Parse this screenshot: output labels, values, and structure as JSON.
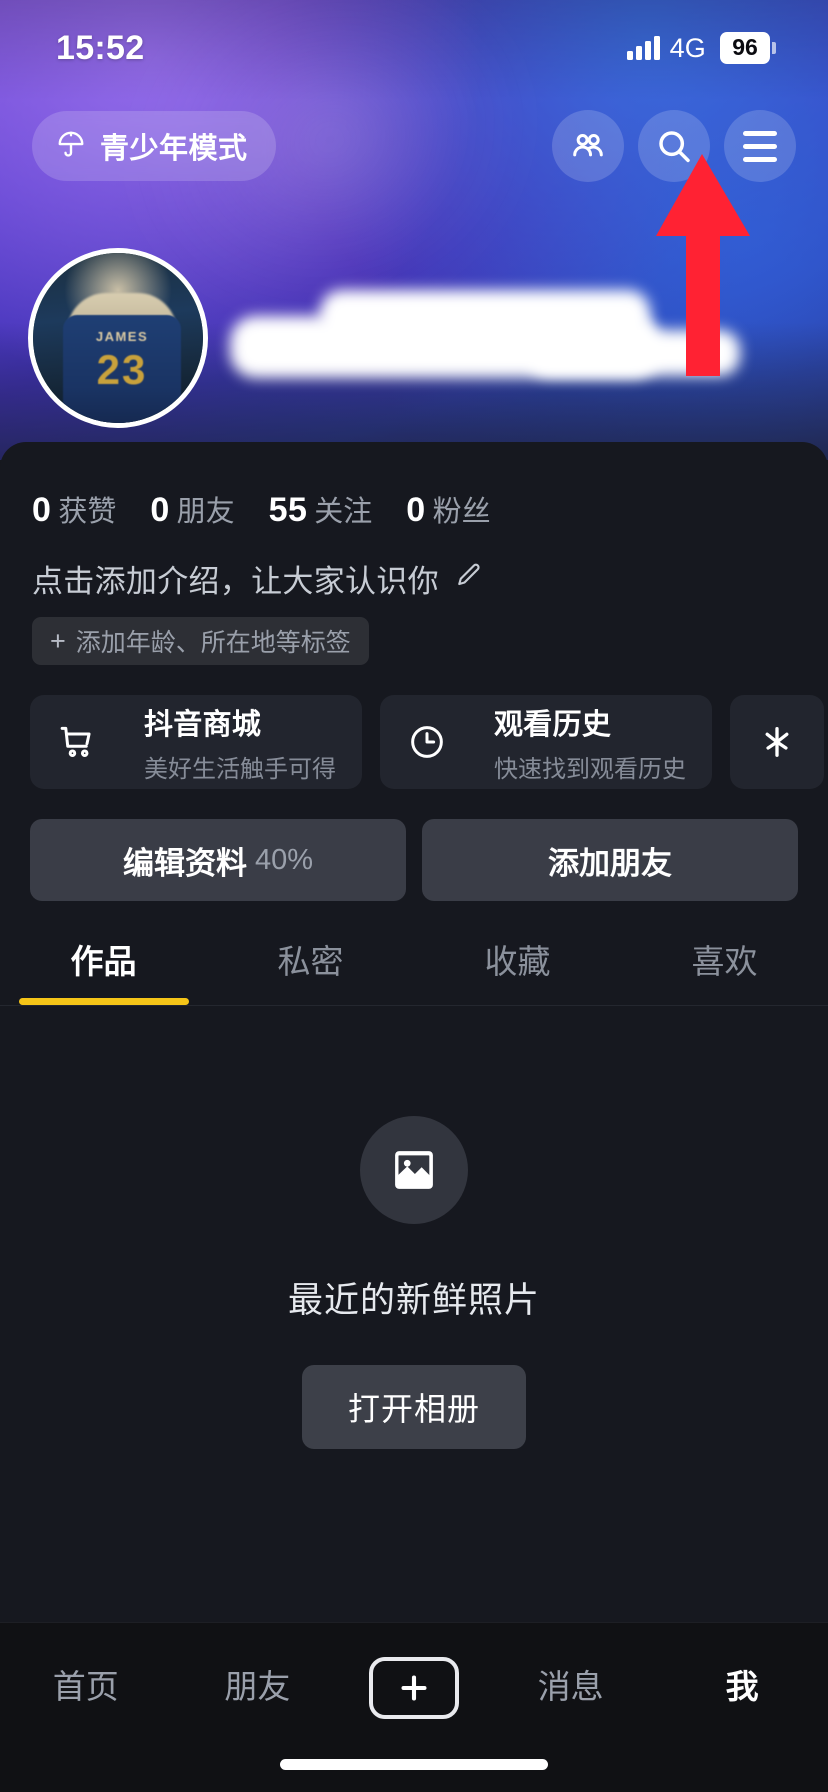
{
  "status_bar": {
    "time": "15:52",
    "network": "4G",
    "battery": "96",
    "signal_icon": "signal-bars-icon",
    "battery_icon": "battery-icon"
  },
  "header": {
    "teen_mode": {
      "label": "青少年模式",
      "icon": "umbrella-icon"
    },
    "actions": [
      {
        "name": "friends-icon",
        "label": ""
      },
      {
        "name": "search-icon",
        "label": ""
      },
      {
        "name": "menu-icon",
        "label": ""
      }
    ]
  },
  "annotation": {
    "type": "arrow",
    "color": "#FF2233",
    "points_to": "menu-icon"
  },
  "profile": {
    "avatar": {
      "icon": "avatar-photo",
      "jersey_name": "JAMES",
      "jersey_number": "23"
    },
    "username_redacted": true,
    "stats": [
      {
        "value": "0",
        "label": "获赞"
      },
      {
        "value": "0",
        "label": "朋友"
      },
      {
        "value": "55",
        "label": "关注"
      },
      {
        "value": "0",
        "label": "粉丝"
      }
    ],
    "bio_placeholder": "点击添加介绍，让大家认识你",
    "bio_edit_icon": "pencil-icon",
    "tag_chip": {
      "plus": "+",
      "label": "添加年龄、所在地等标签"
    }
  },
  "shortcut_cards": [
    {
      "icon": "shopping-cart-icon",
      "title": "抖音商城",
      "subtitle": "美好生活触手可得"
    },
    {
      "icon": "clock-history-icon",
      "title": "观看历史",
      "subtitle": "快速找到观看历史"
    },
    {
      "icon": "spark-icon",
      "title": "",
      "subtitle": ""
    }
  ],
  "action_buttons": {
    "edit_profile": {
      "label": "编辑资料",
      "progress": "40%"
    },
    "add_friend": {
      "label": "添加朋友"
    }
  },
  "content_tabs": [
    {
      "label": "作品",
      "active": true
    },
    {
      "label": "私密",
      "active": false
    },
    {
      "label": "收藏",
      "active": false
    },
    {
      "label": "喜欢",
      "active": false
    }
  ],
  "empty_state": {
    "icon": "photo-icon",
    "title": "最近的新鲜照片",
    "button_label": "打开相册"
  },
  "bottom_nav": [
    {
      "label": "首页",
      "active": false
    },
    {
      "label": "朋友",
      "active": false
    },
    {
      "label": "+",
      "active": false,
      "icon": "plus-create-icon"
    },
    {
      "label": "消息",
      "active": false
    },
    {
      "label": "我",
      "active": true
    }
  ],
  "colors": {
    "accent_yellow": "#F5C518",
    "annotation_red": "#FF2233",
    "sheet_bg": "#16181F",
    "card_bg": "#22252E",
    "button_bg": "#3A3D47",
    "nav_bg": "#101114",
    "muted_text": "#9AA0AB"
  }
}
